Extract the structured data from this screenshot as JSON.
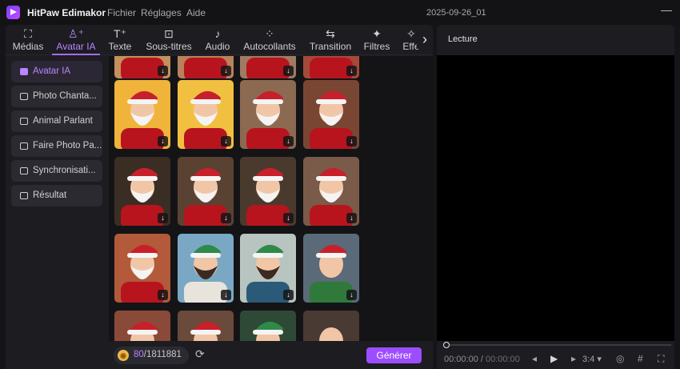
{
  "app": {
    "name": "HitPaw Edimakor",
    "menu": [
      "Fichier",
      "Réglages",
      "Aide"
    ],
    "document_title": "2025-09-26_01",
    "minimize": "—"
  },
  "toolbar": {
    "items": [
      {
        "label": "Médias",
        "icon": "media-icon",
        "glyph": "⛶"
      },
      {
        "label": "Avatar IA",
        "icon": "ai-avatar-icon",
        "glyph": "♙⁺"
      },
      {
        "label": "Texte",
        "icon": "text-icon",
        "glyph": "T⁺"
      },
      {
        "label": "Sous-titres",
        "icon": "subtitles-icon",
        "glyph": "⊡"
      },
      {
        "label": "Audio",
        "icon": "audio-icon",
        "glyph": "♪"
      },
      {
        "label": "Autocollants",
        "icon": "stickers-icon",
        "glyph": "⁘"
      },
      {
        "label": "Transition",
        "icon": "transition-icon",
        "glyph": "⇆"
      },
      {
        "label": "Filtres",
        "icon": "filters-icon",
        "glyph": "✦"
      },
      {
        "label": "Effe",
        "icon": "effects-icon",
        "glyph": "✧"
      }
    ],
    "active": "Avatar IA",
    "next_glyph": "›"
  },
  "sidebar": {
    "items": [
      {
        "label": "Avatar IA",
        "icon": "avatar-icon"
      },
      {
        "label": "Photo Chanta...",
        "icon": "singing-photo-icon"
      },
      {
        "label": "Animal Parlant",
        "icon": "talking-animal-icon"
      },
      {
        "label": "Faire Photo Pa...",
        "icon": "talking-photo-icon"
      },
      {
        "label": "Synchronisati...",
        "icon": "sync-icon"
      },
      {
        "label": "Résultat",
        "icon": "result-icon"
      }
    ],
    "active": "Avatar IA"
  },
  "gallery": {
    "download_glyph": "↓",
    "rows": [
      [
        {
          "subject": "santa",
          "bg": "#c4905c"
        },
        {
          "subject": "santa",
          "bg": "#b8825a"
        },
        {
          "subject": "santa",
          "bg": "#a07a62"
        },
        {
          "subject": "santa",
          "bg": "#a54a3a"
        }
      ],
      [
        {
          "subject": "santa",
          "bg": "#f0b43a"
        },
        {
          "subject": "santa",
          "bg": "#f2c040"
        },
        {
          "subject": "santa",
          "bg": "#8c6a52"
        },
        {
          "subject": "santa",
          "bg": "#7a4634"
        }
      ],
      [
        {
          "subject": "santa",
          "bg": "#3a2e24"
        },
        {
          "subject": "santa",
          "bg": "#5a4232"
        },
        {
          "subject": "santa",
          "bg": "#4a3a2e"
        },
        {
          "subject": "santa",
          "bg": "#7a5a48"
        }
      ],
      [
        {
          "subject": "santa",
          "bg": "#b25a3a"
        },
        {
          "subject": "man-green-hat",
          "bg": "#7aa8c4"
        },
        {
          "subject": "man-green-hat",
          "bg": "#b8c4c0"
        },
        {
          "subject": "elf",
          "bg": "#5a6a78"
        }
      ],
      [
        {
          "subject": "santa",
          "bg": "#8a4a3a"
        },
        {
          "subject": "child-red-hat",
          "bg": "#6a4a3a"
        },
        {
          "subject": "child-green-hat",
          "bg": "#2e4a36"
        },
        {
          "subject": "man",
          "bg": "#4a3a34"
        }
      ]
    ]
  },
  "credits": {
    "coin_glyph": "◉",
    "used": "80",
    "total": "/1811881",
    "refresh_glyph": "⟳"
  },
  "generate_label": "Générer",
  "player": {
    "title": "Lecture",
    "timecode_current": "00:00:00",
    "timecode_sep": " / ",
    "timecode_total": "00:00:00",
    "progress": 0,
    "ratio": "3:4",
    "controls": {
      "prev": "◂",
      "play": "▶",
      "next": "▸",
      "ratio_arrow": "▾",
      "snapshot": "◎",
      "crop": "#",
      "fullscreen": "⛶"
    }
  },
  "colors": {
    "accent": "#a66bff",
    "accent_text": "#b886ff",
    "generate_bg": "#9c4dff",
    "coin": "#f0b64a"
  }
}
